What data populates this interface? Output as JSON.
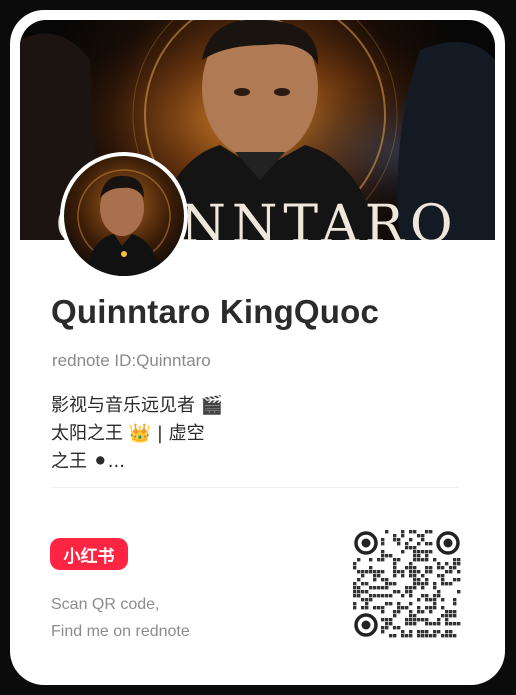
{
  "banner_text": "QUINNTARO",
  "profile": {
    "name": "Quinntaro KingQuoc",
    "rednote_id": "rednote ID:Quinntaro",
    "bio_lines": [
      "影视与音乐远见者 🎬",
      "太阳之王 👑 | 虚空",
      "之王 ⚫..."
    ]
  },
  "footer": {
    "logo_text": "小红书",
    "scan_lines": [
      "Scan QR code,",
      "Find me on rednote"
    ]
  },
  "colors": {
    "brand": "#ff2442",
    "name": "#2b2b2b",
    "muted": "#8a8a8a"
  }
}
